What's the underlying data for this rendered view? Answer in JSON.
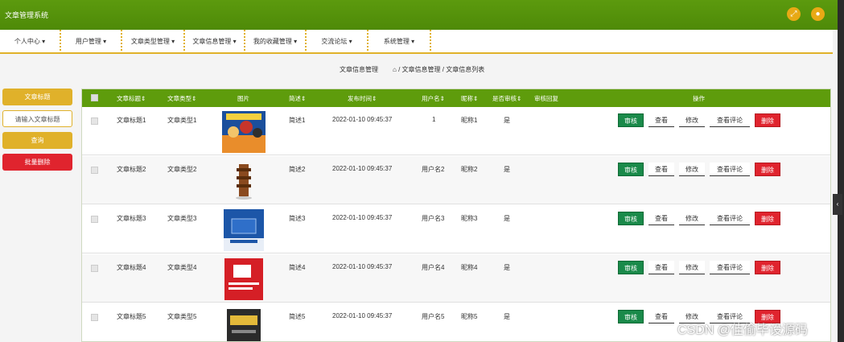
{
  "app": {
    "title": "文章管理系统"
  },
  "top_icons": {
    "fullscreen": "expand-icon",
    "user": "user-icon"
  },
  "nav": {
    "items": [
      {
        "label": "个人中心"
      },
      {
        "label": "用户管理"
      },
      {
        "label": "文章类型管理"
      },
      {
        "label": "文章信息管理"
      },
      {
        "label": "我的收藏管理"
      },
      {
        "label": "交流论坛"
      },
      {
        "label": "系统管理"
      }
    ],
    "caret": "▾"
  },
  "page": {
    "title": "文章信息管理",
    "breadcrumb": "/ 文章信息管理 / 文章信息列表"
  },
  "side": {
    "field_label": "文章标题",
    "search_placeholder": "请输入文章标题",
    "search_button": "查询",
    "batch_delete": "批量删除"
  },
  "table": {
    "headers": [
      "文章标题⇕",
      "文章类型⇕",
      "图片",
      "简述⇕",
      "发布时间⇕",
      "用户名⇕",
      "昵称⇕",
      "是否审核⇕",
      "审核回复",
      "操作"
    ],
    "rows": [
      {
        "title": "文章标题1",
        "type": "文章类型1",
        "summary": "简述1",
        "time": "2022-01-10 09:45:37",
        "user": "1",
        "nick": "昵称1",
        "audited": "是",
        "reply": ""
      },
      {
        "title": "文章标题2",
        "type": "文章类型2",
        "summary": "简述2",
        "time": "2022-01-10 09:45:37",
        "user": "用户名2",
        "nick": "昵称2",
        "audited": "是",
        "reply": ""
      },
      {
        "title": "文章标题3",
        "type": "文章类型3",
        "summary": "简述3",
        "time": "2022-01-10 09:45:37",
        "user": "用户名3",
        "nick": "昵称3",
        "audited": "是",
        "reply": ""
      },
      {
        "title": "文章标题4",
        "type": "文章类型4",
        "summary": "简述4",
        "time": "2022-01-10 09:45:37",
        "user": "用户名4",
        "nick": "昵称4",
        "audited": "是",
        "reply": ""
      },
      {
        "title": "文章标题5",
        "type": "文章类型5",
        "summary": "简述5",
        "time": "2022-01-10 09:45:37",
        "user": "用户名5",
        "nick": "昵称5",
        "audited": "是",
        "reply": ""
      }
    ],
    "actions": {
      "audit": "审核",
      "view": "查看",
      "edit": "修改",
      "comments": "查看评论",
      "delete": "删除"
    }
  },
  "watermark": "CSDN @佳偷毕设源码",
  "colors": {
    "header_green": "#5e9c0c",
    "accent_gold": "#e0b12a",
    "delete_red": "#e0242e",
    "audit_green": "#1a8a4a"
  }
}
